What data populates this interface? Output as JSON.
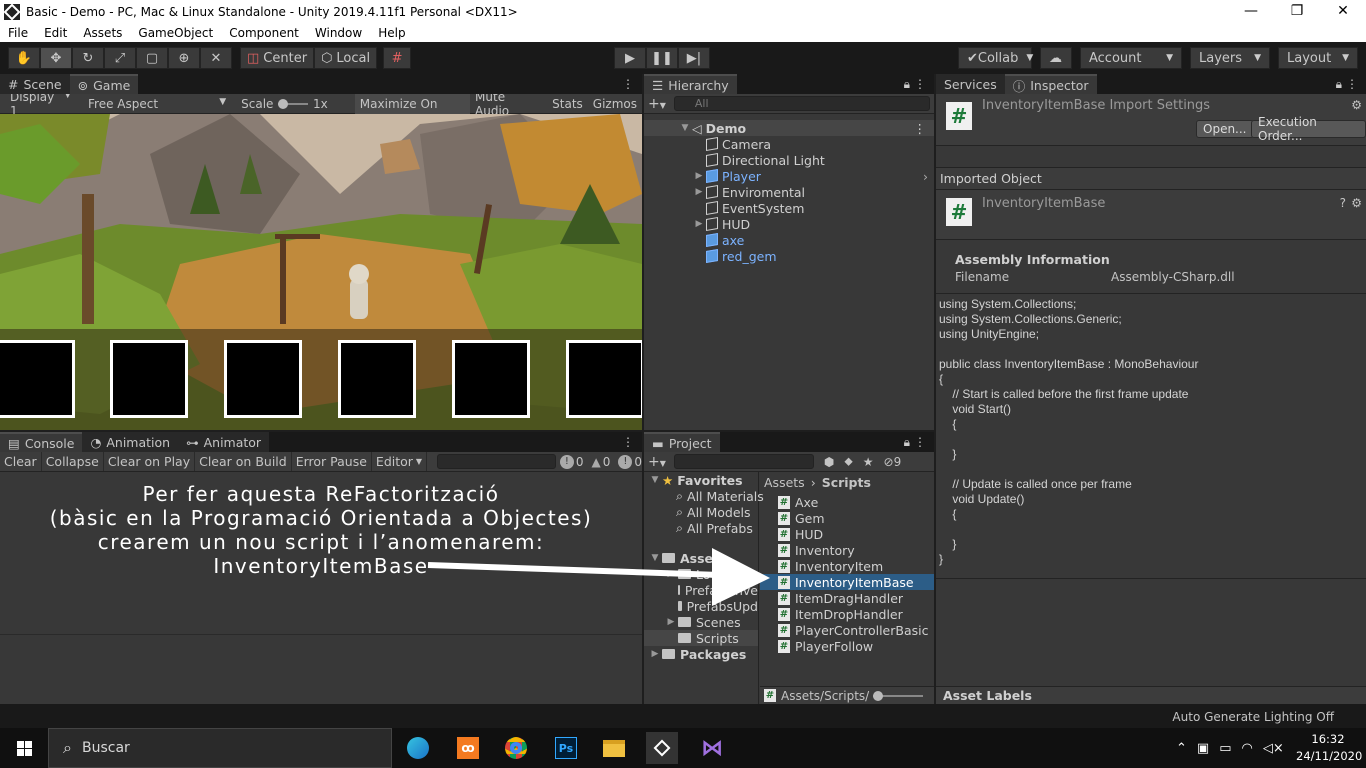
{
  "window": {
    "title": "Basic - Demo - PC, Mac & Linux Standalone - Unity 2019.4.11f1 Personal <DX11>",
    "controls": [
      "—",
      "❐",
      "✕"
    ]
  },
  "menu": [
    "File",
    "Edit",
    "Assets",
    "GameObject",
    "Component",
    "Window",
    "Help"
  ],
  "toolbar": {
    "pivot_center": "Center",
    "pivot_local": "Local",
    "collab": "Collab",
    "account": "Account",
    "layers": "Layers",
    "layout": "Layout"
  },
  "game_panel": {
    "tabs": [
      "Scene",
      "Game"
    ],
    "display": "Display 1",
    "aspect": "Free Aspect",
    "scale_label": "Scale",
    "scale_value": "1x",
    "maximize": "Maximize On Play",
    "mute": "Mute Audio",
    "stats": "Stats",
    "gizmos": "Gizmos",
    "slot_count": 6
  },
  "hierarchy": {
    "tab": "Hierarchy",
    "search_placeholder": "All",
    "scene": "Demo",
    "items": [
      {
        "label": "Camera",
        "blue": false,
        "expandable": false
      },
      {
        "label": "Directional Light",
        "blue": false,
        "expandable": false
      },
      {
        "label": "Player",
        "blue": true,
        "expandable": true
      },
      {
        "label": "Enviromental",
        "blue": false,
        "expandable": true
      },
      {
        "label": "EventSystem",
        "blue": false,
        "expandable": false
      },
      {
        "label": "HUD",
        "blue": false,
        "expandable": true
      },
      {
        "label": "axe",
        "blue": true,
        "expandable": false
      },
      {
        "label": "red_gem",
        "blue": true,
        "expandable": false
      }
    ]
  },
  "console": {
    "tabs": [
      "Console",
      "Animation",
      "Animator"
    ],
    "buttons": [
      "Clear",
      "Collapse",
      "Clear on Play",
      "Clear on Build",
      "Error Pause"
    ],
    "editor": "Editor",
    "counts": {
      "log": "0",
      "warn": "0",
      "error": "0"
    },
    "overlay_lines": [
      "Per fer aquesta ReFactorització",
      "(bàsic en la Programació Orientada a Objectes)",
      "crearem un nou script i l’anomenarem:",
      "InventoryItemBase"
    ]
  },
  "project": {
    "tab": "Project",
    "hidden_count": "9",
    "favorites": "Favorites",
    "favorite_items": [
      "All Materials",
      "All Models",
      "All Prefabs"
    ],
    "assets": "Assets",
    "asset_folders": [
      "Loca",
      "PrefabsInve",
      "PrefabsUpd",
      "Scenes",
      "Scripts"
    ],
    "packages": "Packages",
    "breadcrumb": [
      "Assets",
      "Scripts"
    ],
    "files": [
      "Axe",
      "Gem",
      "HUD",
      "Inventory",
      "InventoryItem",
      "InventoryItemBase",
      "ItemDragHandler",
      "ItemDropHandler",
      "PlayerControllerBasic",
      "PlayerFollow"
    ],
    "selected_file": "InventoryItemBase",
    "footer_path": "Assets/Scripts/"
  },
  "inspector": {
    "tabs": [
      "Services",
      "Inspector"
    ],
    "import_title": "InventoryItemBase Import Settings",
    "open_btn": "Open...",
    "exec_order_btn": "Execution Order...",
    "imported_object": "Imported Object",
    "object_name": "InventoryItemBase",
    "assembly_info": "Assembly Information",
    "filename_label": "Filename",
    "filename_value": "Assembly-CSharp.dll",
    "code": "using System.Collections;\nusing System.Collections.Generic;\nusing UnityEngine;\n\npublic class InventoryItemBase : MonoBehaviour\n{\n    // Start is called before the first frame update\n    void Start()\n    {\n\n    }\n\n    // Update is called once per frame\n    void Update()\n    {\n\n    }\n}",
    "asset_labels": "Asset Labels"
  },
  "status": {
    "lighting": "Auto Generate Lighting Off"
  },
  "taskbar": {
    "search": "Buscar",
    "time": "16:32",
    "date": "24/11/2020"
  }
}
